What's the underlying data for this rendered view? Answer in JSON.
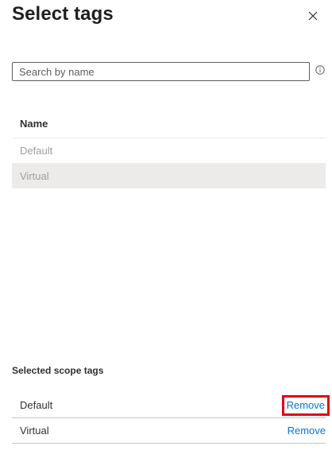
{
  "panel": {
    "title": "Select tags",
    "close_icon": "close-icon"
  },
  "search": {
    "placeholder": "Search by name",
    "value": "",
    "info_icon": "info-icon"
  },
  "tags_table": {
    "column_header": "Name",
    "rows": [
      {
        "name": "Default",
        "selected": false
      },
      {
        "name": "Virtual",
        "selected": true
      }
    ]
  },
  "selected_scope_tags": {
    "label": "Selected scope tags",
    "items": [
      {
        "name": "Default",
        "action_label": "Remove",
        "highlighted": true
      },
      {
        "name": "Virtual",
        "action_label": "Remove",
        "highlighted": false
      }
    ]
  },
  "colors": {
    "accent": "#0078d4",
    "highlight_box": "#e3001b",
    "selected_row_bg": "#edebe9",
    "muted_text": "#a19f9d"
  }
}
